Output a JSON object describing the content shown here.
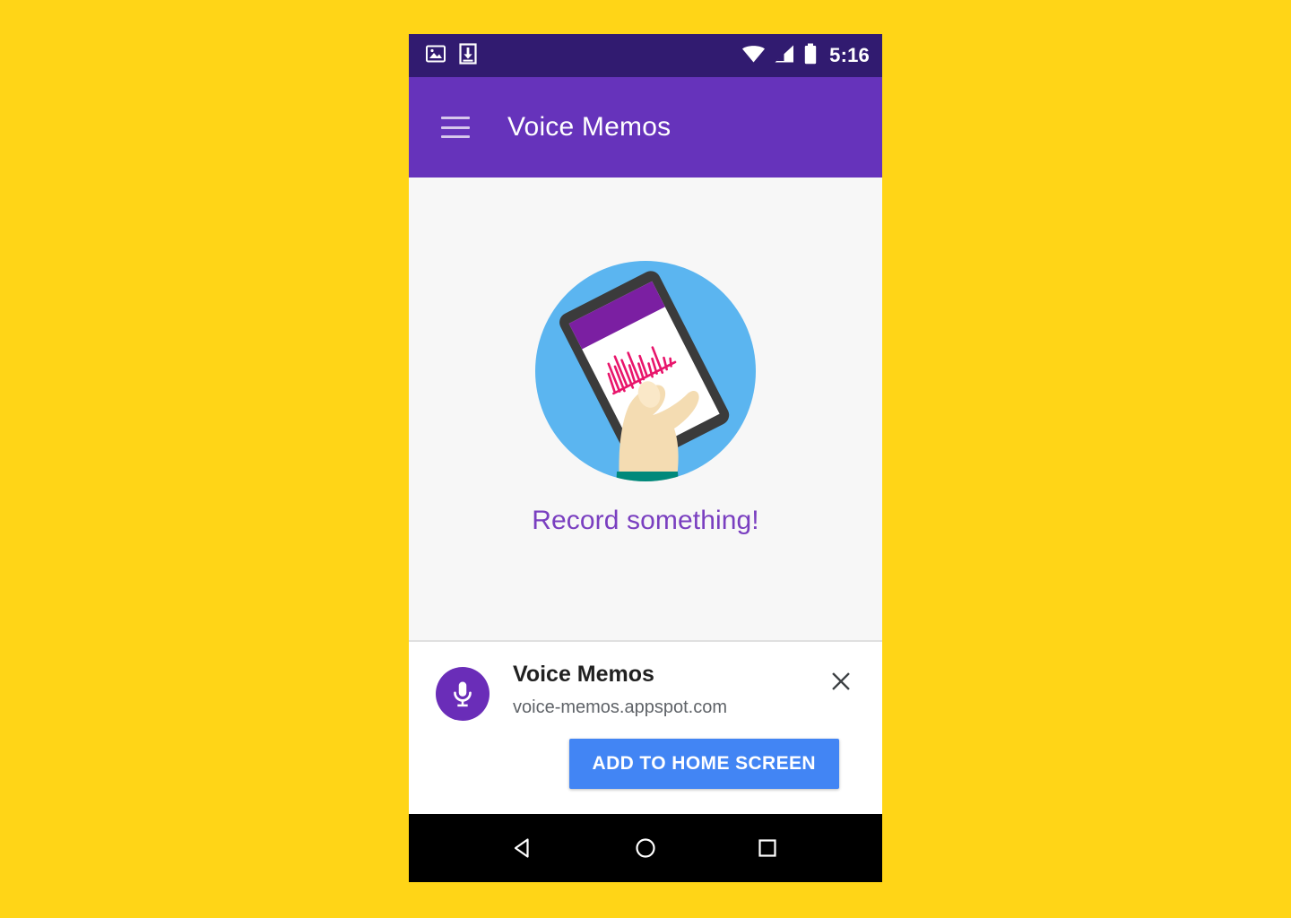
{
  "page": {
    "background_color": "#FFD517"
  },
  "status_bar": {
    "background_color": "#311B70",
    "time": "5:16",
    "left_icons": [
      {
        "name": "photo-icon",
        "label": "Screenshot captured"
      },
      {
        "name": "download-icon",
        "label": "Download complete"
      }
    ],
    "right_icons": [
      {
        "name": "wifi-icon",
        "label": "Wi-Fi connected"
      },
      {
        "name": "cellular-signal-icon",
        "label": "Cellular signal"
      },
      {
        "name": "battery-icon",
        "label": "Battery"
      }
    ]
  },
  "app_bar": {
    "background_color": "#6633BB",
    "title": "Voice Memos",
    "menu_icon": "hamburger-menu-icon"
  },
  "content": {
    "background_color": "#F7F7F7",
    "empty_state_text": "Record something!",
    "empty_state_text_color": "#7A3FC0",
    "illustration": {
      "name": "hand-holding-phone-illustration",
      "circle_color": "#5BB5F0",
      "phone_frame_color": "#3B3B3B",
      "phone_appbar_color": "#7B1FA2",
      "phone_screen_color": "#FFFFFF",
      "waveform_color": "#E8156B",
      "skin_color": "#F4DCB2",
      "sleeve_color": "#00897B"
    }
  },
  "install_banner": {
    "background_color": "#FFFFFF",
    "app_name": "Voice Memos",
    "app_url": "voice-memos.appspot.com",
    "app_icon": {
      "name": "microphone-icon",
      "circle_color": "#6A2DB8",
      "glyph_color": "#FFFFFF"
    },
    "close_icon": "close-icon",
    "add_button_label": "ADD TO HOME SCREEN",
    "add_button_color": "#4285F4",
    "add_button_text_color": "#FFFFFF"
  },
  "nav_bar": {
    "background_color": "#000000",
    "buttons": [
      {
        "name": "back-button",
        "icon": "triangle-back-icon"
      },
      {
        "name": "home-button",
        "icon": "circle-home-icon"
      },
      {
        "name": "recents-button",
        "icon": "square-recents-icon"
      }
    ]
  }
}
